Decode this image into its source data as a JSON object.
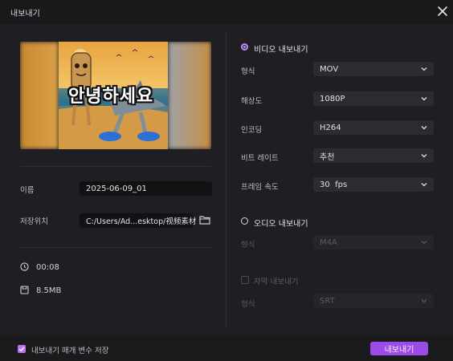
{
  "window": {
    "title": "내보내기"
  },
  "preview": {
    "overlay_text": "안녕하세요"
  },
  "file": {
    "name_label": "이름",
    "name_value": "2025-06-09_01",
    "save_label": "저장위치",
    "save_path": "C:/Users/Ad...esktop/视频素材",
    "duration": "00:08",
    "size": "8.5MB"
  },
  "video_export": {
    "heading": "비디오 내보내기",
    "rows": [
      {
        "label": "형식",
        "value": "MOV"
      },
      {
        "label": "해상도",
        "value": "1080P"
      },
      {
        "label": "인코딩",
        "value": "H264"
      },
      {
        "label": "비트 레이트",
        "value": "추천"
      },
      {
        "label": "프레임 속도",
        "value": "30  fps"
      }
    ]
  },
  "audio_export": {
    "heading": "오디오 내보내기",
    "format_label": "형식",
    "format_value": "M4A"
  },
  "subtitle_export": {
    "heading": "자막 내보내기",
    "format_label": "형식",
    "format_value": "SRT"
  },
  "footer": {
    "save_params_label": "내보내기 매개 변수 저장",
    "export_button": "내보내기"
  },
  "colors": {
    "accent": "#9b4be8",
    "radio_on": "#c38bf7",
    "background": "#1f1f23"
  }
}
